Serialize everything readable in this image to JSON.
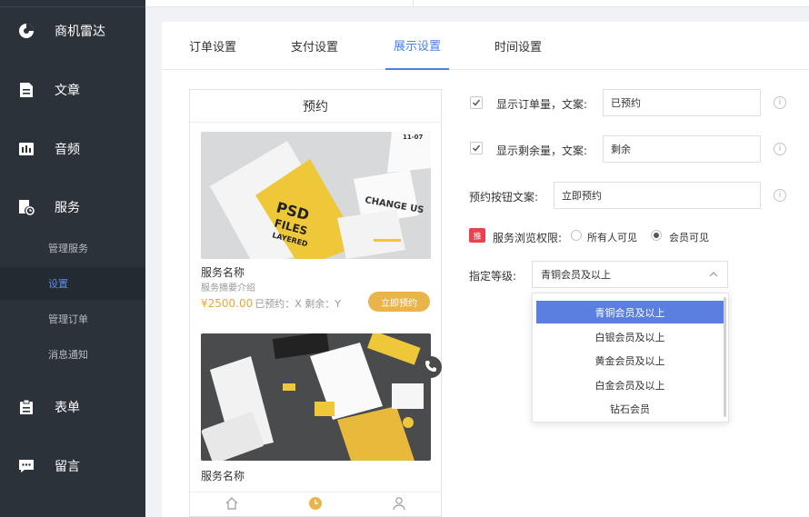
{
  "sidebar": {
    "items": [
      {
        "label": "商机雷达",
        "icon": "pie-chart-icon"
      },
      {
        "label": "文章",
        "icon": "document-icon"
      },
      {
        "label": "音频",
        "icon": "audio-icon"
      },
      {
        "label": "服务",
        "icon": "service-icon"
      },
      {
        "label": "表单",
        "icon": "clipboard-icon"
      },
      {
        "label": "留言",
        "icon": "message-icon"
      }
    ],
    "sub_items": [
      {
        "label": "管理服务",
        "active": false
      },
      {
        "label": "设置",
        "active": true
      },
      {
        "label": "管理订单",
        "active": false
      },
      {
        "label": "消息通知",
        "active": false
      }
    ]
  },
  "tabs": [
    {
      "label": "订单设置",
      "active": false
    },
    {
      "label": "支付设置",
      "active": false
    },
    {
      "label": "展示设置",
      "active": true
    },
    {
      "label": "时间设置",
      "active": false
    }
  ],
  "preview": {
    "title": "预约",
    "card1": {
      "image_text": [
        "PSD",
        "FILES",
        "LAYERED",
        "CHANGE US",
        "11-07"
      ],
      "name": "服务名称",
      "desc": "服务摘要介绍",
      "price": "¥2500.00",
      "meta": "已预约：X  剩余：Y",
      "button": "立即预约"
    },
    "card2": {
      "name": "服务名称"
    }
  },
  "settings": {
    "show_order_count": {
      "checked": true,
      "label": "显示订单量，文案:",
      "value": "已预约"
    },
    "show_remaining": {
      "checked": true,
      "label": "显示剩余量，文案:",
      "value": "剩余"
    },
    "button_text": {
      "label": "预约按钮文案:",
      "value": "立即预约"
    },
    "visibility": {
      "badge": "推",
      "label": "服务浏览权限:",
      "options": [
        {
          "label": "所有人可见",
          "checked": false
        },
        {
          "label": "会员可见",
          "checked": true
        }
      ]
    },
    "level": {
      "label": "指定等级:",
      "selected": "青铜会员及以上",
      "options": [
        "青铜会员及以上",
        "白银会员及以上",
        "黄金会员及以上",
        "白金会员及以上",
        "钻石会员"
      ]
    }
  },
  "colors": {
    "sidebar_bg": "#2b323a",
    "accent": "#4a7fe6",
    "button_yellow": "#e9b44c",
    "dropdown_selected": "#5b7fe0"
  }
}
